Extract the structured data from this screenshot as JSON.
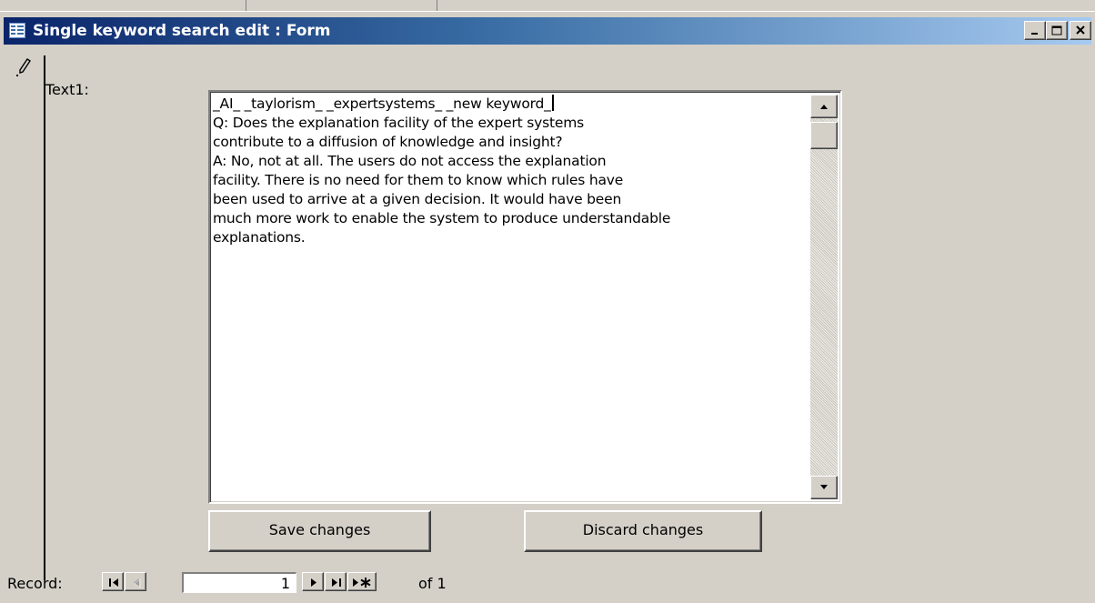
{
  "window": {
    "title": "Single keyword search edit : Form"
  },
  "form": {
    "field_label": "Text1:",
    "memo_first_line": "_AI_ _taylorism_ _expertsystems_ _new keyword_",
    "memo_body": "Q: Does the explanation facility of the expert systems\ncontribute to a diffusion of knowledge and insight?\nA: No, not at all. The users do not access the explanation\nfacility. There is no need for them to know which rules have\nbeen used to arrive at a given decision. It would have been\nmuch more work to enable the system to produce understandable\nexplanations.",
    "save_label": "Save changes",
    "discard_label": "Discard changes"
  },
  "navigation": {
    "record_label": "Record:",
    "current_record": "1",
    "of_label": "of",
    "total_records": "1"
  },
  "icons": {
    "form": "form-icon",
    "pencil": "pencil-edit-icon",
    "minimize": "minimize-icon",
    "maximize": "maximize-icon",
    "close": "close-icon"
  },
  "colors": {
    "titlebar_start": "#0a246a",
    "titlebar_end": "#a6caf0",
    "face": "#d4d0c8"
  }
}
